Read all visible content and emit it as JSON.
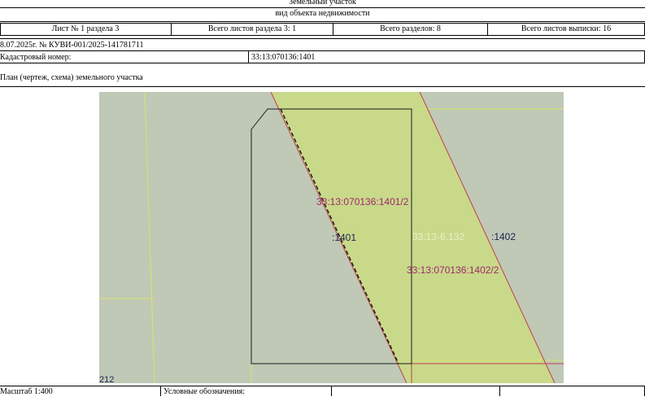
{
  "header": {
    "title": "Земельный участок",
    "subtitle": "вид объекта недвижимости"
  },
  "sheet_row": {
    "sheet": "Лист № 1 раздела 3",
    "sheets_in_section": "Всего листов раздела 3: 1",
    "sections_total": "Всего разделов: 8",
    "sheets_total": "Всего листов выписки: 16"
  },
  "document_ref": "8.07.2025г. № КУВИ-001/2025-141781711",
  "cadastral": {
    "label": "Кадастровый номер:",
    "value": "33:13:070136:1401"
  },
  "plan_title": "План (чертеж, схема) земельного участка",
  "map": {
    "labels": {
      "part_1401_2": "33:13:070136:1401/2",
      "parcel_1401": ":1401",
      "zone": "33:13-6.132",
      "parcel_1402": ":1402",
      "part_1402_2": "33:13:070136:1402/2",
      "corner_fragment": "212"
    },
    "colors": {
      "background": "#bfc9b6",
      "zone_fill": "#c9d98a",
      "part_label": "#a0286a",
      "zone_label": "#e9efc9",
      "parcel_label": "#1e2050",
      "boundary_red": "#c0404a",
      "boundary_yellow": "#dde26a"
    }
  },
  "footer": {
    "scale": "Масштаб 1:400",
    "legend": "Условные обозначения:"
  }
}
